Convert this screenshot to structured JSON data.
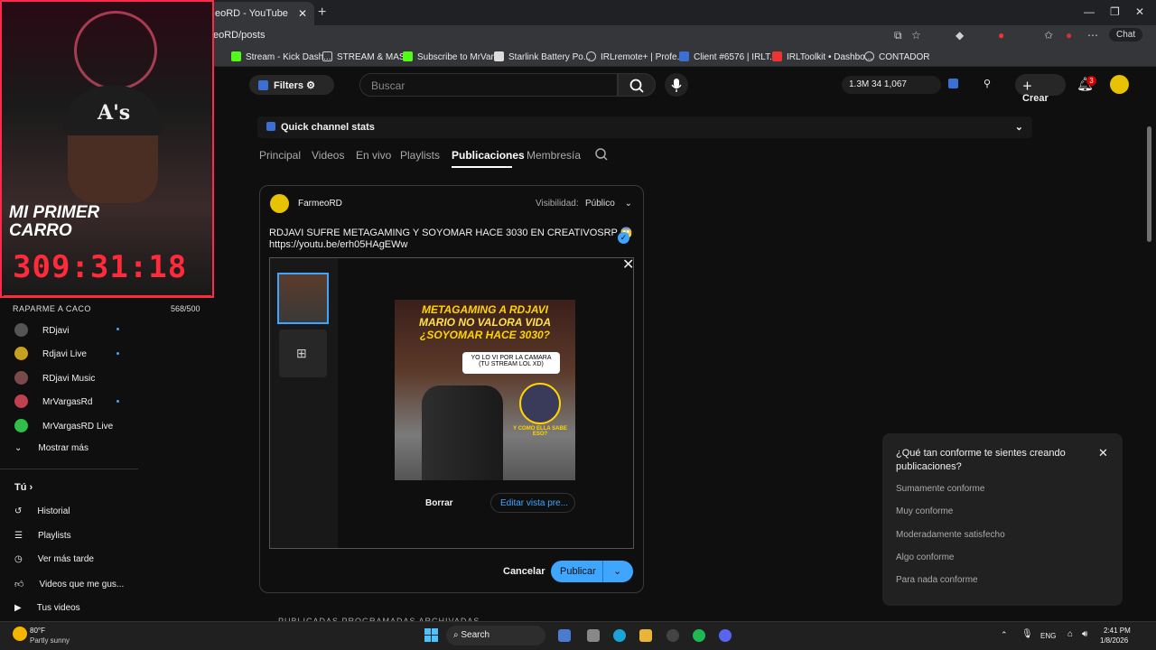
{
  "browser": {
    "tab_title": "eoRD - YouTube",
    "url": "eoRD/posts",
    "chat_label": "Chat"
  },
  "bookmarks": [
    "Stream - Kick Dash...",
    "STREAM & MAS",
    "Subscribe to MrVar...",
    "Starlink Battery Po...",
    "IRLremote+ | Profe...",
    "Client #6576 | IRLT...",
    "IRLToolkit • Dashbo...",
    "CONTADOR"
  ],
  "header": {
    "filters": "Filters",
    "search_placeholder": "Buscar",
    "stats": "1.3M   34   1,067",
    "crear": "Crear",
    "notif_count": "3"
  },
  "quick_stats": "Quick channel stats",
  "tabs": [
    "Principal",
    "Videos",
    "En vivo",
    "Playlists",
    "Publicaciones",
    "Membresía"
  ],
  "post": {
    "channel": "FarmeoRD",
    "visibility_label": "Visibilidad:",
    "visibility_value": "Público",
    "text_line1": "RDJAVI SUFRE METAGAMING Y SOYOMAR HACE 3030 EN CREATIVOSRP 😱",
    "text_line2": "https://youtu.be/erh05HAgEWw",
    "image_title1": "METAGAMING A RDJAVI",
    "image_title2": "MARIO NO VALORA VIDA",
    "image_title3": "¿SOYOMAR HACE 3030?",
    "image_bubble": "YO LO VI POR LA CAMARA (TU STREAM LOL XD)",
    "image_badge": "Y COMO ELLA SABE ESO?",
    "delete": "Borrar",
    "edit_preview": "Editar vista pre...",
    "cancel": "Cancelar",
    "publish": "Publicar"
  },
  "bottom_tabs": "PUBLICADAS   PROGRAMADAS   ARCHIVADAS",
  "sidebar": {
    "subs": [
      "RDjavi",
      "Rdjavi Live",
      "RDjavi Music",
      "MrVargasRd",
      "MrVargasRD Live"
    ],
    "more": "Mostrar más",
    "you": "Tú",
    "items": [
      "Historial",
      "Playlists",
      "Ver más tarde",
      "Videos que me gus...",
      "Tus videos"
    ]
  },
  "overlay": {
    "cap_logo": "A's",
    "title": "MI PRIMER CARRO",
    "timer": "309:31:18",
    "goal_label": "RAPARME A CACO",
    "goal_count": "568/500"
  },
  "survey": {
    "question": "¿Qué tan conforme te sientes creando publicaciones?",
    "options": [
      "Sumamente conforme",
      "Muy conforme",
      "Moderadamente satisfecho",
      "Algo conforme",
      "Para nada conforme"
    ]
  },
  "taskbar": {
    "temp": "80°F",
    "condition": "Partly sunny",
    "search": "Search",
    "lang": "ENG",
    "time": "2:41 PM",
    "date": "1/8/2026"
  },
  "colors": {
    "accent": "#3ea6ff",
    "overlay_red": "#ff2a3a"
  }
}
